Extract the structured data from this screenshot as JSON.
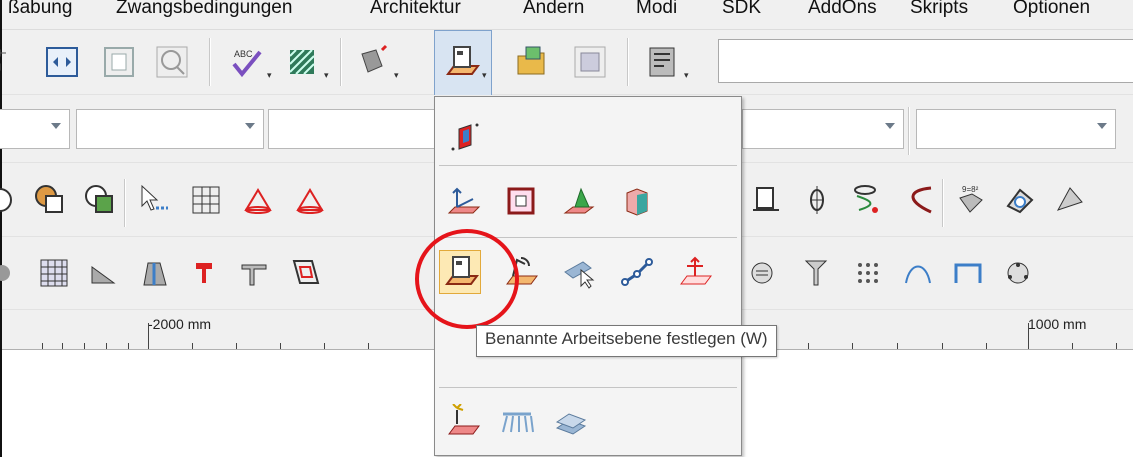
{
  "menubar": {
    "items": [
      "ßabung",
      "Zwangsbedingungen",
      "Architektur",
      "Ändern",
      "Modi",
      "SDK",
      "AddOns",
      "Skripts",
      "Optionen"
    ]
  },
  "ruler": {
    "labels": [
      "-2000 mm",
      "1000 mm"
    ]
  },
  "tooltip": {
    "text": "Benannte Arbeitsebene festlegen (W)"
  },
  "colors": {
    "accent_red": "#e5141a",
    "highlight": "#fde9b4",
    "active": "#d8e4f2"
  },
  "icons": {
    "selected": "named-workplane-icon"
  }
}
